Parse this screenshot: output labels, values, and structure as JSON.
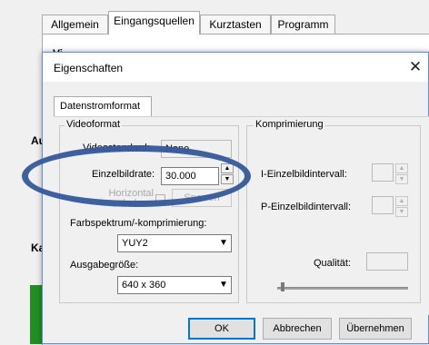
{
  "outer": {
    "tabs": [
      {
        "label": "Allgemein"
      },
      {
        "label": "Eingangsquellen"
      },
      {
        "label": "Kurztasten"
      },
      {
        "label": "Programm"
      }
    ],
    "behind_labels": [
      "Vi",
      "A",
      "Au",
      "A",
      "Ka",
      "K"
    ]
  },
  "dialog": {
    "title": "Eigenschaften",
    "close_glyph": "✕",
    "tab": "Datenstromformat",
    "videoformat": {
      "group_label": "Videoformat",
      "videostandard_label": "Videostandard:",
      "videostandard_value": "None",
      "einzelbildrate_label": "Einzelbildrate:",
      "einzelbildrate_value": "30.000",
      "horizontal_label": "Horizontal drehen:",
      "horizontal_button": "Sperren",
      "farbspektrum_label": "Farbspektrum/-komprimierung:",
      "farbspektrum_value": "YUY2",
      "ausgabegroesse_label": "Ausgabegröße:",
      "ausgabegroesse_value": "640 x 360"
    },
    "komprimierung": {
      "group_label": "Komprimierung",
      "i_label": "I-Einzelbildintervall:",
      "p_label": "P-Einzelbildintervall:",
      "qualitaet_label": "Qualität:"
    },
    "buttons": {
      "ok": "OK",
      "abbrechen": "Abbrechen",
      "uebernehmen": "Übernehmen"
    }
  },
  "colors": {
    "dialog_border": "#5b8fd9",
    "annotation_ellipse": "#34579a",
    "default_button_border": "#0078d7"
  },
  "icons": {
    "close": "close-icon",
    "spin_up": "spin-up-icon",
    "spin_down": "spin-down-icon",
    "combo": "chevron-down-icon"
  }
}
